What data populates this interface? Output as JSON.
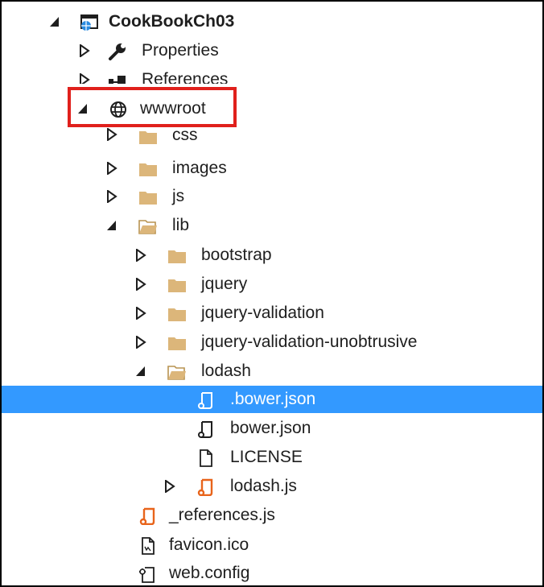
{
  "tree": {
    "project": "CookBookCh03",
    "properties": "Properties",
    "references": "References",
    "wwwroot": "wwwroot",
    "css": "css",
    "images": "images",
    "js": "js",
    "lib": "lib",
    "bootstrap": "bootstrap",
    "jquery": "jquery",
    "jquery_validation": "jquery-validation",
    "jquery_validation_unobtrusive": "jquery-validation-unobtrusive",
    "lodash": "lodash",
    "dot_bower_json": ".bower.json",
    "bower_json": "bower.json",
    "license": "LICENSE",
    "lodash_js": "lodash.js",
    "references_js": "_references.js",
    "favicon": "favicon.ico",
    "web_config": "web.config"
  },
  "colors": {
    "selection": "#3399ff",
    "highlight_box": "#e0201c",
    "folder": "#dcb67a",
    "js_file": "#e8641b"
  },
  "selected_item": ".bower.json"
}
